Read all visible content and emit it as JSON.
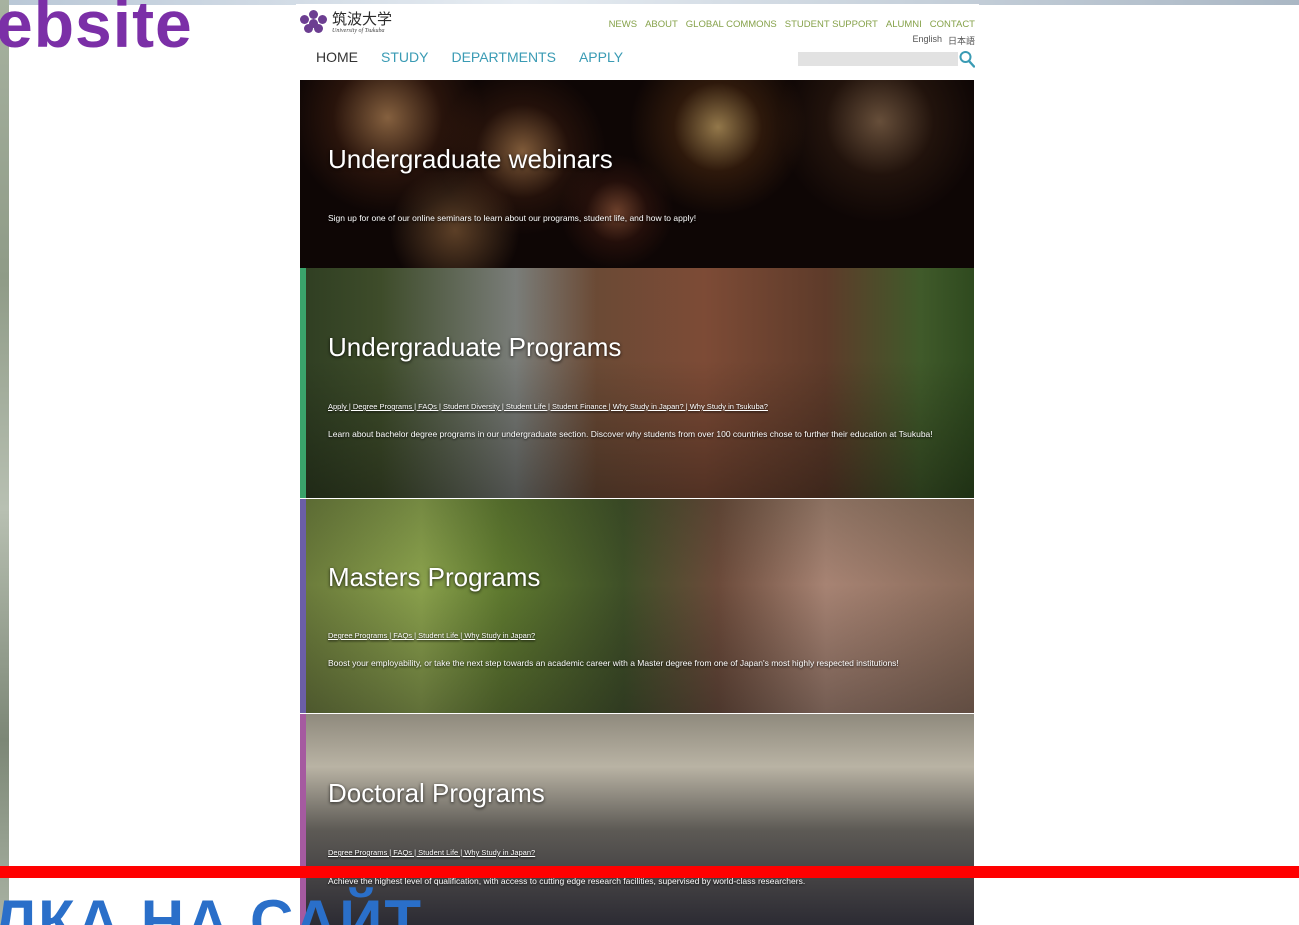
{
  "slide": {
    "title_top": "ebsite",
    "title_bottom": "ЛКА НА САЙТ"
  },
  "site": {
    "logo": {
      "jp": "筑波大学",
      "en": "University of Tsukuba"
    },
    "utility_nav": [
      "NEWS",
      "ABOUT",
      "GLOBAL COMMONS",
      "STUDENT SUPPORT",
      "ALUMNI",
      "CONTACT"
    ],
    "languages": [
      "English",
      "日本語"
    ],
    "main_nav": [
      "HOME",
      "STUDY",
      "DEPARTMENTS",
      "APPLY"
    ],
    "search": {
      "placeholder": ""
    },
    "panels": {
      "webinar": {
        "title": "Undergraduate webinars",
        "desc": "Sign up for one of our online seminars to learn about our programs, student life, and how to apply!"
      },
      "undergrad": {
        "title": "Undergraduate Programs",
        "links": "Apply | Degree Programs | FAQs | Student Diversity | Student Life | Student Finance | Why Study in Japan? | Why Study in Tsukuba?",
        "desc": "Learn about bachelor degree programs in our undergraduate section.  Discover why students from over 100 countries chose to further their education at Tsukuba!"
      },
      "masters": {
        "title": "Masters Programs",
        "links": "Degree Programs | FAQs | Student Life | Why Study in Japan?",
        "desc": "Boost your employability, or take the next step towards an academic career with a Master degree from one of Japan's most highly respected institutions!"
      },
      "doctoral": {
        "title": "Doctoral Programs",
        "links": "Degree Programs | FAQs | Student Life | Why Study in Japan?",
        "desc": "Achieve the highest level of qualification, with access to cutting edge research facilities, supervised by world-class researchers."
      }
    }
  },
  "colors": {
    "slide_title_top": "#7b2fa7",
    "slide_title_bottom": "#2a6fc9",
    "red_bar": "#ff0000",
    "utility_nav": "#86a24a",
    "main_nav": "#3a9bb4",
    "accent_undergrad": "#3aa36b",
    "accent_masters": "#6b5ea6",
    "accent_doctoral": "#a55aa0"
  }
}
